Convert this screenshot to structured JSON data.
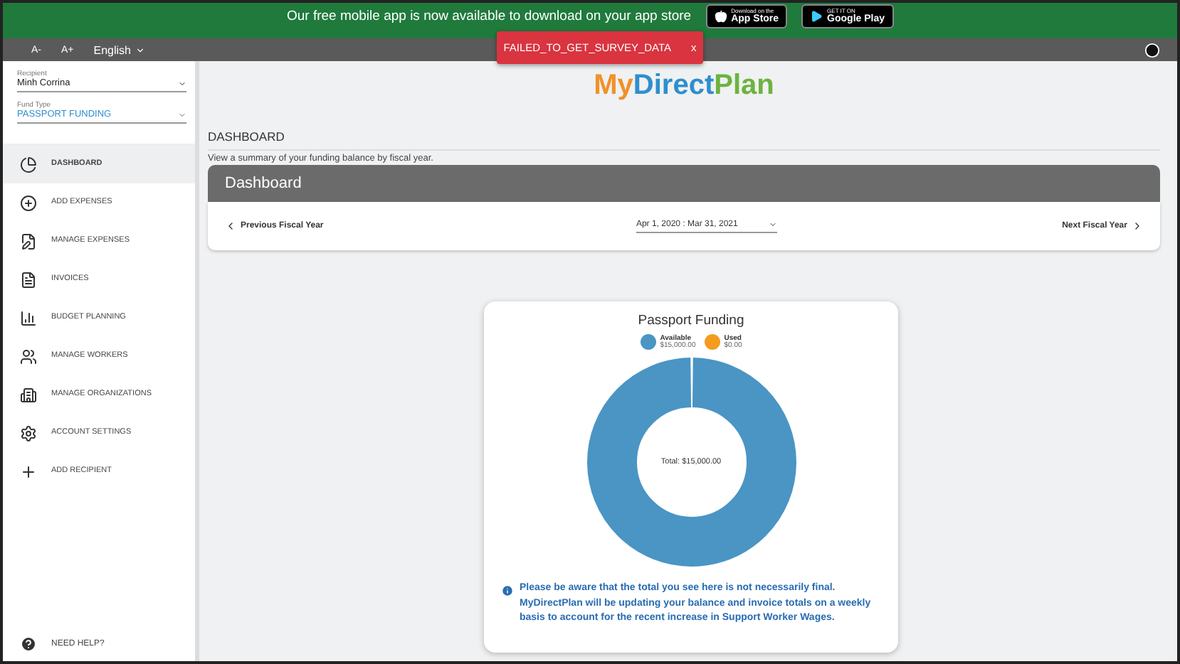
{
  "banner": {
    "text": "Our free mobile app is now available to download on your app store",
    "badges": [
      {
        "kind": "apple",
        "caption": "Download on the",
        "label": "App Store"
      },
      {
        "kind": "google",
        "caption": "GET IT ON",
        "label": "Google Play"
      }
    ]
  },
  "toolbar": {
    "font_buttons": [
      "A-",
      "A+"
    ],
    "language": "English"
  },
  "error_toast": {
    "text": "FAILED_TO_GET_SURVEY_DATA",
    "close": "x"
  },
  "sidebar": {
    "recipient": {
      "label": "Recipient",
      "value": "Minh Corrina"
    },
    "fund_type": {
      "label": "Fund Type",
      "value": "PASSPORT FUNDING"
    },
    "items": [
      {
        "label": "DASHBOARD",
        "selected": true
      },
      {
        "label": "ADD EXPENSES",
        "selected": false
      },
      {
        "label": "MANAGE EXPENSES",
        "selected": false
      },
      {
        "label": "INVOICES",
        "selected": false
      },
      {
        "label": "BUDGET PLANNING",
        "selected": false
      },
      {
        "label": "MANAGE WORKERS",
        "selected": false
      },
      {
        "label": "MANAGE ORGANIZATIONS",
        "selected": false
      },
      {
        "label": "ACCOUNT SETTINGS",
        "selected": false
      },
      {
        "label": "ADD RECIPIENT",
        "selected": false
      }
    ],
    "help": "NEED HELP?"
  },
  "logo": [
    {
      "text": "My",
      "color": "#f0912a"
    },
    {
      "text": "Direct",
      "color": "#2e8fcf"
    },
    {
      "text": "Plan",
      "color": "#6cb33f"
    }
  ],
  "page": {
    "title": "DASHBOARD",
    "subtitle": "View a summary of your funding balance by fiscal year."
  },
  "dashboard": {
    "header": "Dashboard",
    "previous": "Previous Fiscal Year",
    "period": "Apr 1, 2020 : Mar 31, 2021",
    "next": "Next Fiscal Year"
  },
  "funding_card": {
    "title": "Passport Funding",
    "legend": [
      {
        "label": "Available",
        "amount": "$15,000.00",
        "color": "#4a95c4"
      },
      {
        "label": "Used",
        "amount": "$0.00",
        "color": "#f39c1f"
      }
    ],
    "total": "Total: $15,000.00",
    "notice": "Please be aware that the total you see here is not necessarily final. MyDirectPlan will be updating your balance and invoice totals on a weekly basis to account for the recent increase in Support Worker Wages."
  }
}
